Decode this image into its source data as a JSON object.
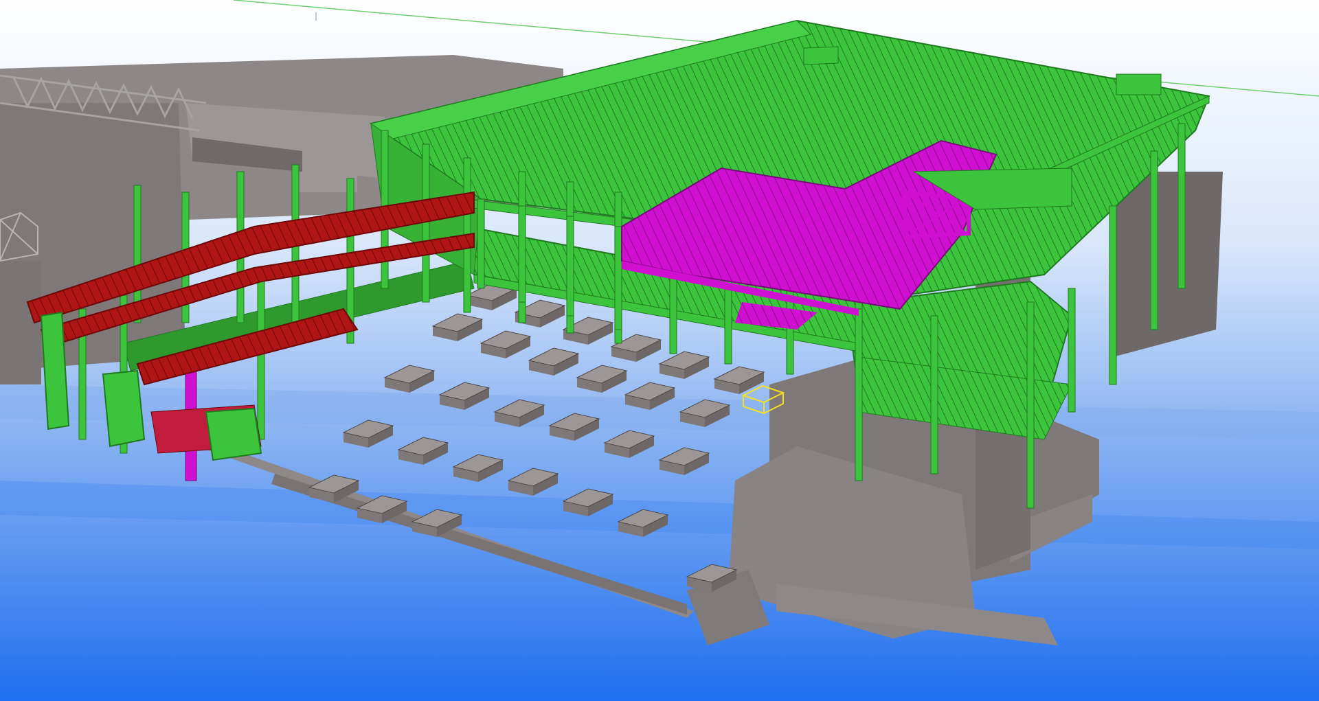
{
  "viewport": {
    "background_top": "#ffffff",
    "background_mid": "#9fc3f4",
    "background_bottom": "#1f6ff0"
  },
  "colors": {
    "steel_erected": "#3cc43c",
    "steel_edge": "#1f7a1f",
    "steel_deck": "#2e9a2e",
    "steel_fabricated": "#b01515",
    "steel_fabricated_edge": "#6e0808",
    "steel_in_progress": "#d010d0",
    "steel_in_progress_edge": "#7a0a7a",
    "concrete": "#7f7878",
    "concrete_top": "#9c9696",
    "concrete_edge": "#4d4747",
    "existing_building": "#8d8787",
    "selection_outline": "#f2e020"
  },
  "model": {
    "footings": [
      {
        "id": "F-1"
      },
      {
        "id": "F-2"
      },
      {
        "id": "F-3"
      },
      {
        "id": "F-4"
      },
      {
        "id": "F-5"
      },
      {
        "id": "F-6"
      },
      {
        "id": "F-7"
      },
      {
        "id": "F-8"
      },
      {
        "id": "F-9"
      },
      {
        "id": "F-10"
      },
      {
        "id": "F-11"
      },
      {
        "id": "F-12"
      },
      {
        "id": "F-13"
      },
      {
        "id": "F-14"
      },
      {
        "id": "F-15"
      },
      {
        "id": "F-16"
      },
      {
        "id": "F-17"
      },
      {
        "id": "F-18"
      },
      {
        "id": "F-19"
      },
      {
        "id": "F-20"
      },
      {
        "id": "F-21"
      },
      {
        "id": "F-22"
      },
      {
        "id": "F-23"
      },
      {
        "id": "F-24"
      },
      {
        "id": "F-25"
      },
      {
        "id": "F-26"
      },
      {
        "id": "F-27"
      },
      {
        "id": "F-28"
      }
    ]
  }
}
